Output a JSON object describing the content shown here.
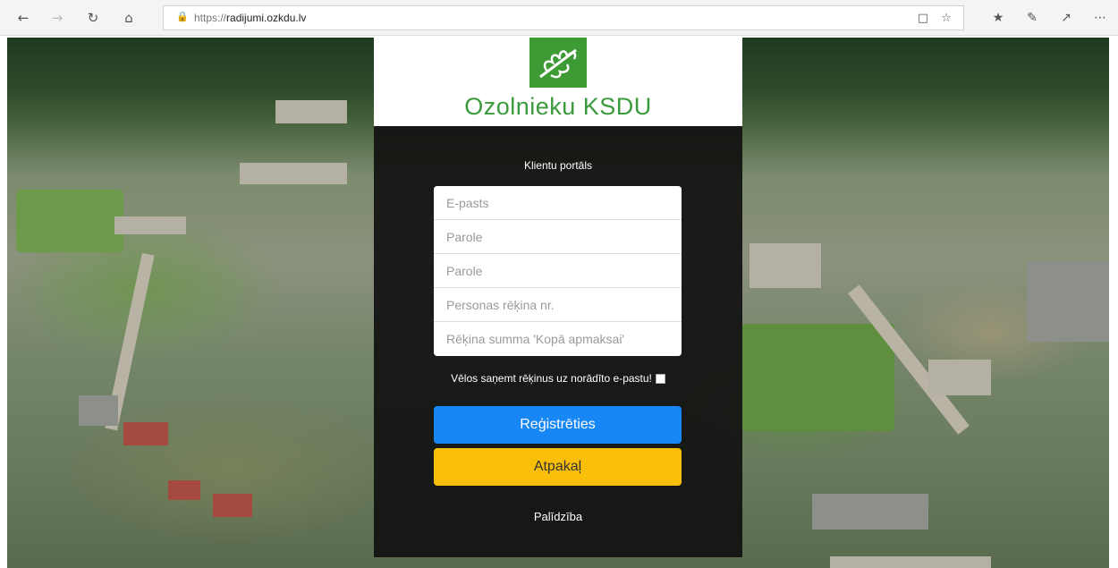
{
  "browser": {
    "url_prefix": "https://",
    "url_host": "radijumi.ozkdu.lv",
    "icons": {
      "back": "back-arrow-icon",
      "forward": "forward-arrow-icon",
      "refresh": "refresh-icon",
      "home": "home-icon",
      "lock": "lock-icon",
      "reading_view": "reading-view-icon",
      "favorite": "star-icon",
      "favorites_list": "favorites-icon",
      "notes": "pen-icon",
      "share": "share-icon",
      "more": "more-icon"
    }
  },
  "logo": {
    "text": "Ozolnieku KSDU",
    "color": "#3a9a3c",
    "mark_color": "#3d9a35"
  },
  "form": {
    "title": "Klientu portāls",
    "fields": [
      {
        "placeholder": "E-pasts"
      },
      {
        "placeholder": "Parole"
      },
      {
        "placeholder": "Parole"
      },
      {
        "placeholder": "Personas rēķina nr."
      },
      {
        "placeholder": "Rēķina summa 'Kopā apmaksai'"
      }
    ],
    "consent_label": "Vēlos saņemt rēķinus uz norādīto e-pastu!",
    "register_label": "Reģistrēties",
    "back_label": "Atpakaļ",
    "help_label": "Palīdzība",
    "register_color": "#1787f5",
    "back_color": "#f8be08"
  }
}
